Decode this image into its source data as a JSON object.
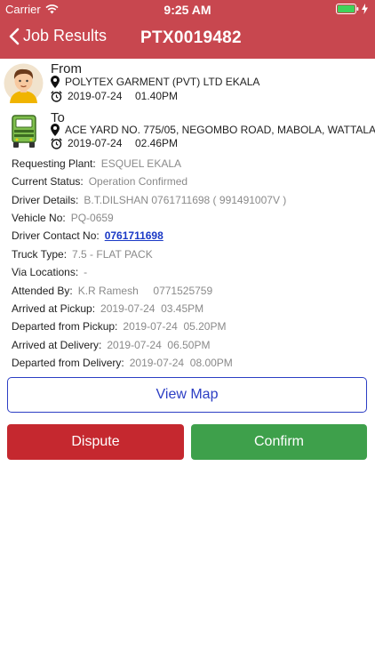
{
  "status_bar": {
    "carrier": "Carrier",
    "time": "9:25 AM"
  },
  "nav": {
    "back_label": "Job Results",
    "title": "PTX0019482"
  },
  "from": {
    "heading": "From",
    "location": "POLYTEX GARMENT (PVT) LTD EKALA",
    "date": "2019-07-24",
    "time": "01.40PM"
  },
  "to": {
    "heading": "To",
    "location": "ACE YARD NO. 775/05, NEGOMBO ROAD, MABOLA, WATTALA",
    "date": "2019-07-24",
    "time": "02.46PM"
  },
  "details": {
    "requesting_plant": {
      "label": "Requesting Plant:",
      "value": "ESQUEL EKALA"
    },
    "current_status": {
      "label": "Current Status:",
      "value": "Operation Confirmed"
    },
    "driver_details": {
      "label": "Driver Details:",
      "value": "B.T.DILSHAN 0761711698 ( 991491007V )"
    },
    "vehicle_no": {
      "label": "Vehicle No:",
      "value": "PQ-0659"
    },
    "driver_contact": {
      "label": "Driver Contact No:",
      "value": "0761711698"
    },
    "truck_type": {
      "label": "Truck Type:",
      "value": "7.5 - FLAT PACK"
    },
    "via_locations": {
      "label": "Via Locations:",
      "value": "-"
    },
    "attended_by": {
      "label": "Attended By:",
      "value": "K.R Ramesh     0771525759"
    },
    "arrived_pickup": {
      "label": "Arrived at Pickup:",
      "value": "2019-07-24  03.45PM"
    },
    "departed_pickup": {
      "label": "Departed from Pickup:",
      "value": "2019-07-24  05.20PM"
    },
    "arrived_delivery": {
      "label": "Arrived at Delivery:",
      "value": "2019-07-24  06.50PM"
    },
    "departed_delivery": {
      "label": "Departed from Delivery:",
      "value": "2019-07-24  08.00PM"
    }
  },
  "actions": {
    "view_map": "View Map",
    "dispute": "Dispute",
    "confirm": "Confirm"
  },
  "colors": {
    "header": "#c8474f",
    "dispute": "#c5282f",
    "confirm": "#3ea04b",
    "link": "#1a39c6"
  }
}
